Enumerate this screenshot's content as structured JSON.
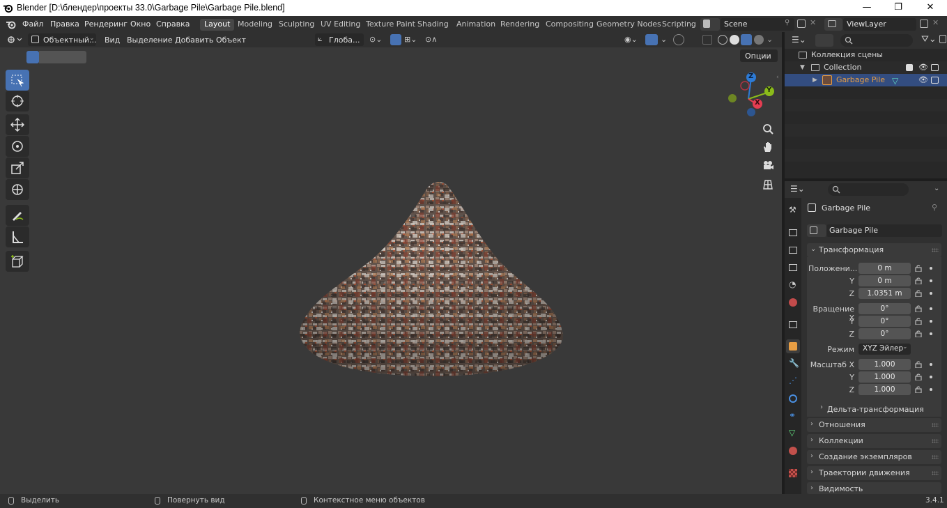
{
  "window": {
    "title": "Blender [D:\\блендер\\проекты 33.0\\Garbage Pile\\Garbage Pile.blend]",
    "minimize": "—",
    "maximize": "❐",
    "close": "✕"
  },
  "menubar": {
    "items": [
      "Файл",
      "Правка",
      "Рендеринг",
      "Окно",
      "Справка"
    ]
  },
  "workspaces": [
    "Layout",
    "Modeling",
    "Sculpting",
    "UV Editing",
    "Texture Paint",
    "Shading",
    "Animation",
    "Rendering",
    "Compositing",
    "Geometry Nodes",
    "Scripting"
  ],
  "active_workspace": "Layout",
  "scene": {
    "name": "Scene"
  },
  "viewlayer": {
    "name": "ViewLayer"
  },
  "viewport_header": {
    "mode": "Объектный...",
    "menus": [
      "Вид",
      "Выделение",
      "Добавить",
      "Объект"
    ],
    "transform_orientation": "Глоба...",
    "options": "Опции"
  },
  "gizmo": {
    "z": "Z",
    "y": "Y",
    "x": "X"
  },
  "outliner": {
    "root": "Коллекция сцены",
    "collection": "Collection",
    "object": "Garbage Pile"
  },
  "properties": {
    "object_name": "Garbage Pile",
    "object_name_field": "Garbage Pile",
    "transform_title": "Трансформация",
    "location_label": "Положени...",
    "location": {
      "x": "0 m",
      "y": "0 m",
      "z": "1.0351 m"
    },
    "rotation_label": "Вращение X",
    "rotation": {
      "x": "0°",
      "y": "0°",
      "z": "0°"
    },
    "mode_label": "Режим",
    "mode_value": "XYZ Эйлер",
    "scale_label": "Масштаб X",
    "scale": {
      "x": "1.000",
      "y": "1.000",
      "z": "1.000"
    },
    "axis_y": "Y",
    "axis_z": "Z",
    "delta": "Дельта-трансформация",
    "panels": [
      "Отношения",
      "Коллекции",
      "Создание экземпляров",
      "Траектории движения",
      "Видимость"
    ]
  },
  "statusbar": {
    "select": "Выделить",
    "rotate": "Повернуть вид",
    "context": "Контекстное меню объектов",
    "version": "3.4.1"
  },
  "colors": {
    "active_blue": "#4772b3",
    "selected_orange": "#e89e44",
    "x_axis": "#e53d52",
    "y_axis": "#8bbb1a",
    "z_axis": "#2d7bd6"
  }
}
